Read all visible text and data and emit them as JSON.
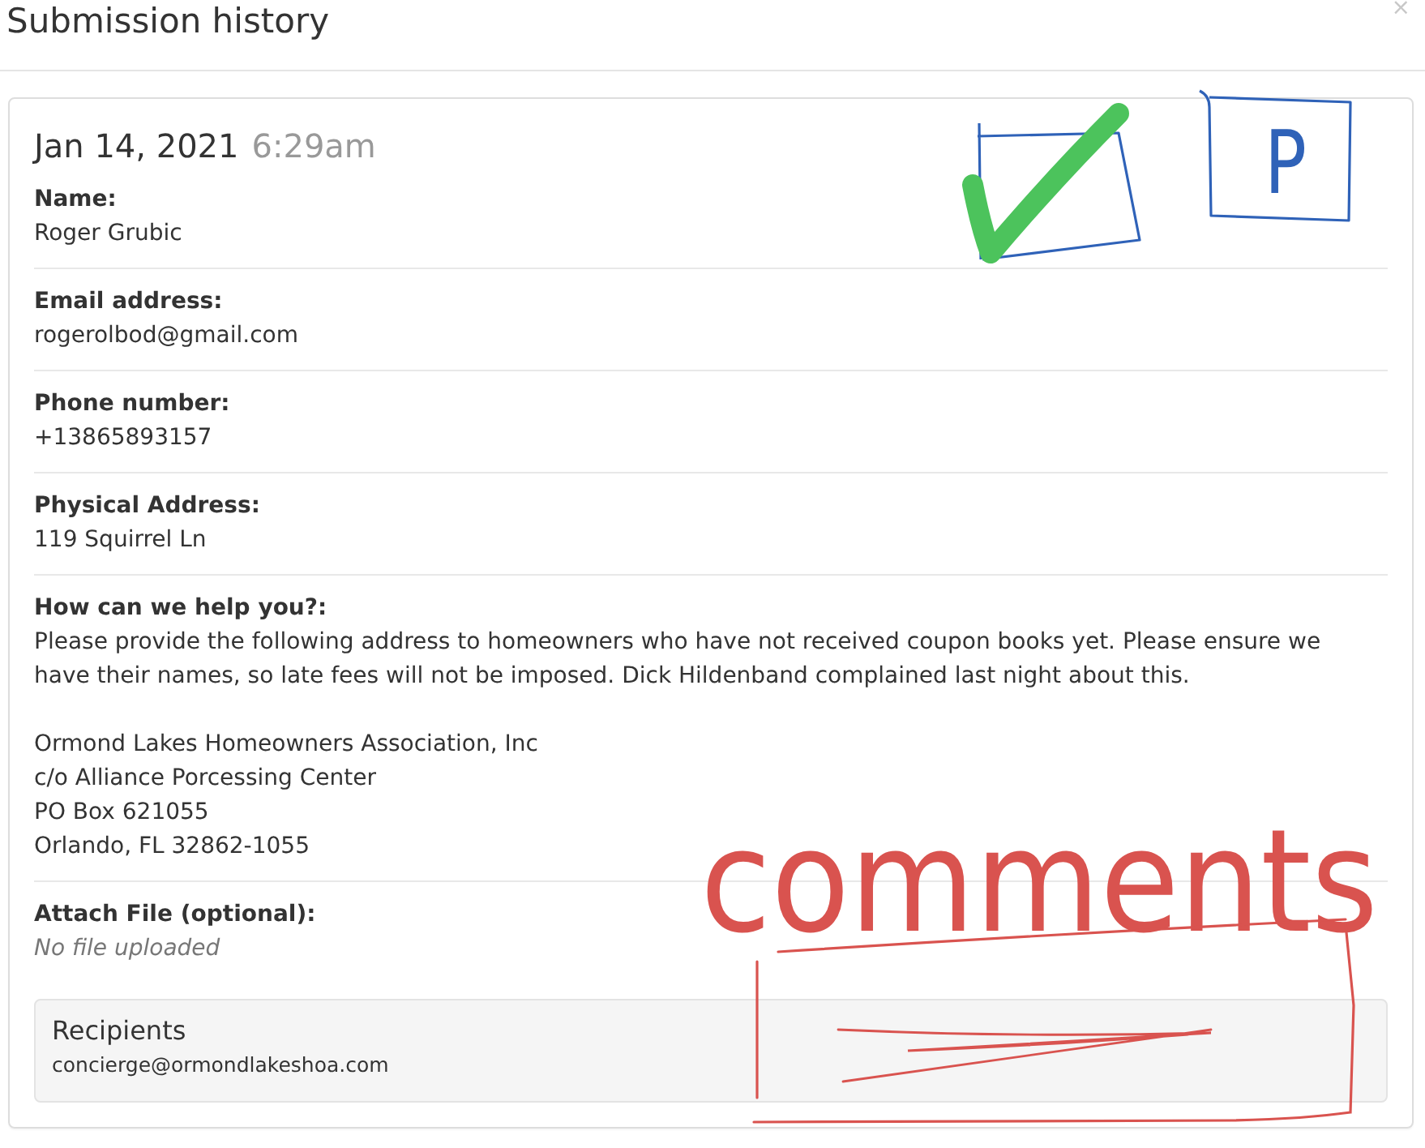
{
  "dialog": {
    "title": "Submission history",
    "close_label": "×"
  },
  "submission": {
    "date": "Jan 14, 2021",
    "time": "6:29am",
    "fields": [
      {
        "kind": "text",
        "label": "Name:",
        "value": "Roger Grubic"
      },
      {
        "kind": "text",
        "label": "Email address:",
        "value": "rogerolbod@gmail.com"
      },
      {
        "kind": "text",
        "label": "Phone number:",
        "value": "+13865893157"
      },
      {
        "kind": "text",
        "label": "Physical Address:",
        "value": "119 Squirrel Ln"
      },
      {
        "kind": "message",
        "label": "How can we help you?:",
        "paragraphs": [
          {
            "lines": [
              "Please provide the following address to homeowners who have not received coupon books yet. Please ensure we have their names, so late fees will not be imposed. Dick Hildenband complained last night about this."
            ]
          },
          {
            "lines": [
              "Ormond Lakes Homeowners Association, Inc",
              "c/o Alliance Porcessing Center",
              "PO Box 621055",
              "Orlando, FL 32862-1055"
            ]
          }
        ]
      },
      {
        "kind": "file",
        "label": "Attach File (optional):",
        "value": "No file uploaded"
      }
    ]
  },
  "recipients": {
    "title": "Recipients",
    "emails": [
      "concierge@ormondlakeshoa.com"
    ]
  },
  "annotations": [
    {
      "kind": "checkbox",
      "checked": true
    },
    {
      "kind": "letter-box",
      "text": "P"
    },
    {
      "kind": "handwriting",
      "text": "comments"
    },
    {
      "kind": "scribble-box"
    }
  ]
}
